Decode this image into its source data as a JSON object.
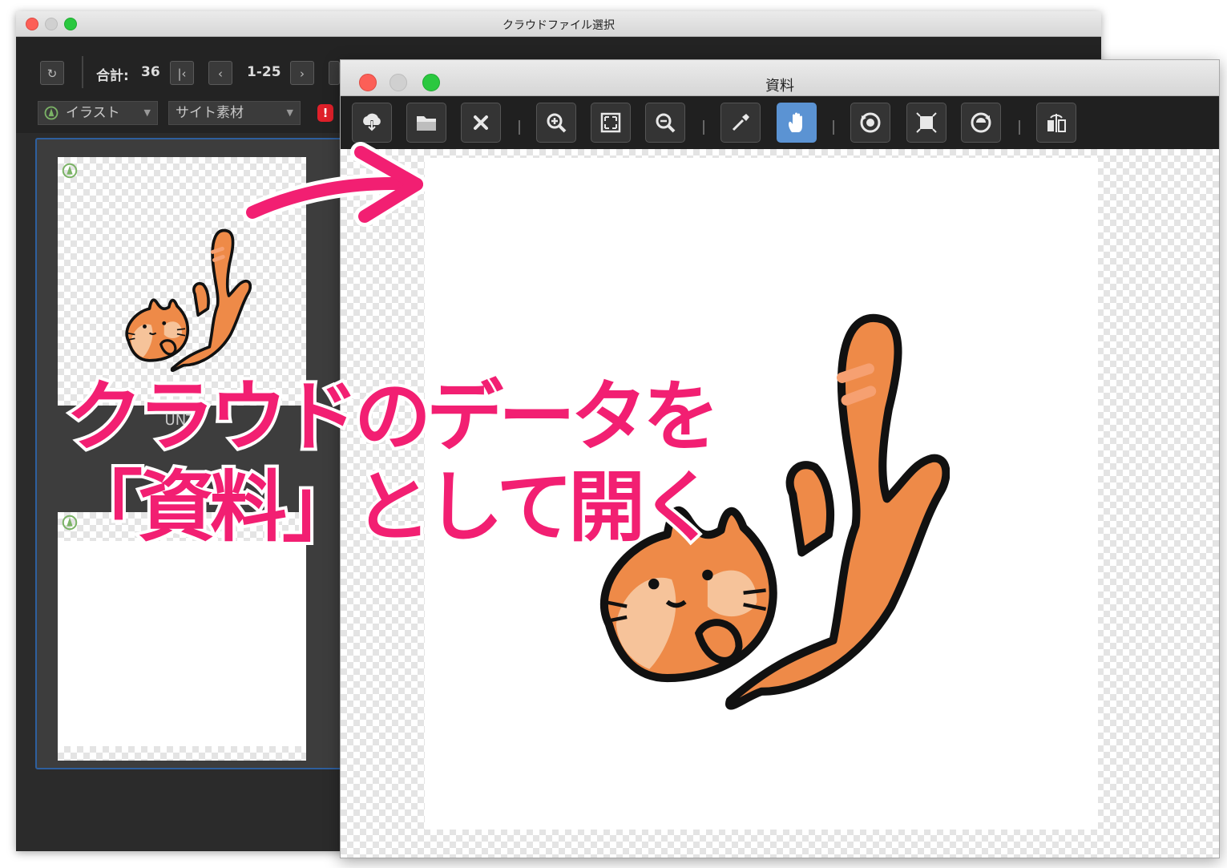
{
  "back_window": {
    "title": "クラウドファイル選択",
    "total_label": "合計:",
    "total_count": "36",
    "page_range": "1-25",
    "category_select": "イラスト",
    "type_select": "サイト素材",
    "item_caption": "UNTI"
  },
  "front_window": {
    "title": "資料",
    "toolbar_icons": [
      "cloud-download-icon",
      "folder-open-icon",
      "close-icon",
      "zoom-in-icon",
      "fit-to-window-icon",
      "zoom-out-icon",
      "eyedropper-icon",
      "hand-icon",
      "rotate-left-icon",
      "fit-icon",
      "rotate-right-icon",
      "flip-icon"
    ],
    "active_tool": "hand-icon"
  },
  "callout": {
    "line1": "クラウドのデータを",
    "line2": "「資料」として開く",
    "color": "#f21f72"
  },
  "colors": {
    "accent_blue": "#5b93d3",
    "cat_orange": "#ee8a48",
    "cat_light": "#f6c39a"
  }
}
